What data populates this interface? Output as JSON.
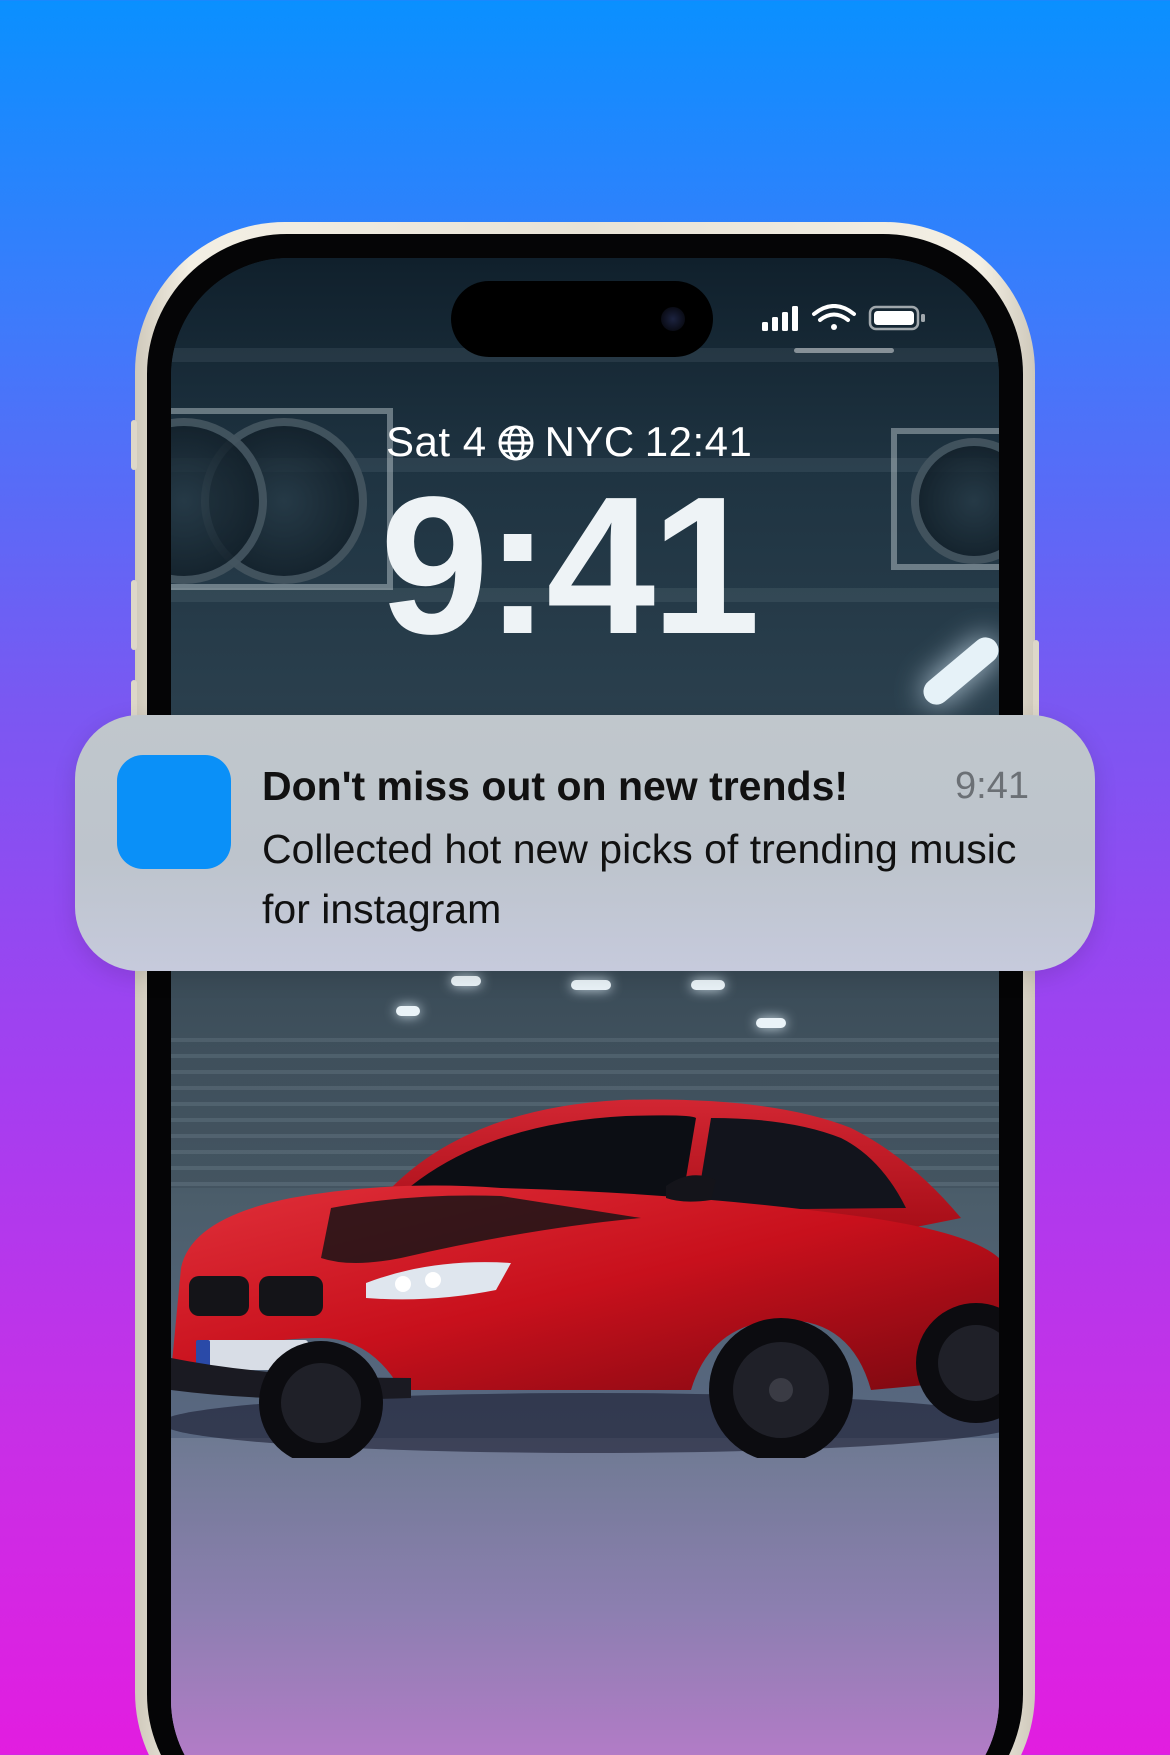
{
  "lockscreen": {
    "date_line": "Sat 4",
    "city": "NYC",
    "world_time": "12:41",
    "time": "9:41",
    "icons": [
      "globe-icon",
      "cellular-signal-icon",
      "wifi-icon",
      "battery-icon"
    ]
  },
  "notification": {
    "title": "Don't miss out on new trends!",
    "time": "9:41",
    "body": "Collected hot new picks of trending music for instagram",
    "app_icon_color": "#0a90f8"
  },
  "colors": {
    "background_top": "#0a90ff",
    "background_bottom": "#e21de0",
    "car_red": "#c8101c"
  }
}
